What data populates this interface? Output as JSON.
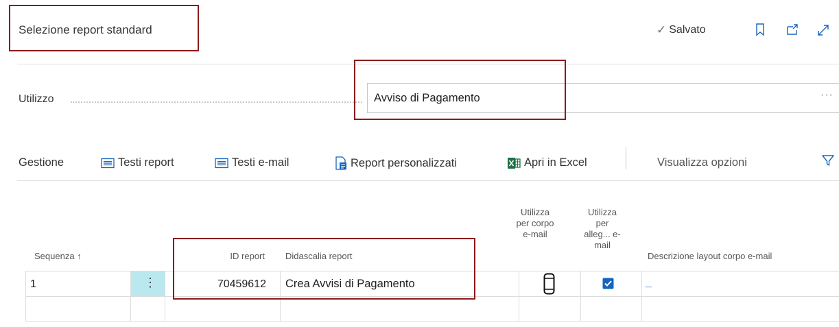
{
  "header": {
    "title": "Selezione report standard",
    "saved_label": "Salvato"
  },
  "field": {
    "label": "Utilizzo",
    "value": "Avviso di Pagamento",
    "ellipsis": "···"
  },
  "actions": {
    "gestione": "Gestione",
    "testi_report": "Testi report",
    "testi_email": "Testi e-mail",
    "report_personalizzati": "Report personalizzati",
    "apri_excel": "Apri in Excel",
    "visualizza_opzioni": "Visualizza opzioni"
  },
  "table": {
    "headers": {
      "sequenza": "Sequenza",
      "sort_arrow": "↑",
      "id_report": "ID report",
      "didascalia": "Didascalia report",
      "corpo_email": "Utilizza per corpo e-mail",
      "allegato_email": "Utilizza per alleg... e-mail",
      "descrizione_layout": "Descrizione layout corpo e-mail"
    },
    "rows": [
      {
        "sequenza": "1",
        "menu": "⋮",
        "id_report": "70459612",
        "didascalia": "Crea Avvisi di Pagamento",
        "corpo_email": false,
        "allegato_email": true,
        "descrizione_layout": "_"
      }
    ]
  },
  "colors": {
    "highlight_border": "#8b1a1a",
    "accent_blue": "#1565c0",
    "menu_cell_bg": "#b9e9ef",
    "excel_green": "#1e7145"
  }
}
